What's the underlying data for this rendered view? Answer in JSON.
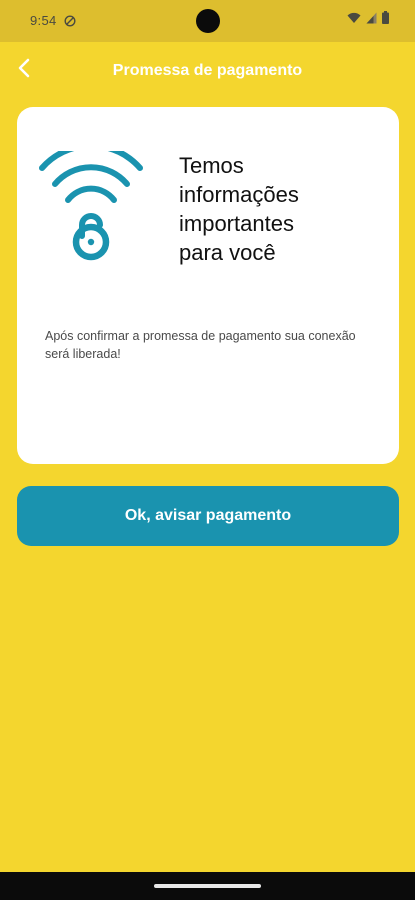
{
  "status_bar": {
    "time": "9:54",
    "icons": [
      "do-not-disturb-icon",
      "wifi-icon",
      "cellular-signal-icon",
      "battery-icon"
    ]
  },
  "header": {
    "title": "Promessa de pagamento",
    "back_icon": "chevron-left-icon"
  },
  "card": {
    "icon": "wifi-lock-icon",
    "heading": "Temos\n informações\n importantes\n para você",
    "message": "Após confirmar a promessa de pagamento sua conexão será liberada!"
  },
  "actions": {
    "confirm_label": "Ok, avisar pagamento"
  },
  "colors": {
    "background": "#F4D62E",
    "status_bar": "#DDBE2E",
    "accent": "#1A93AF",
    "card": "#FFFFFF"
  }
}
